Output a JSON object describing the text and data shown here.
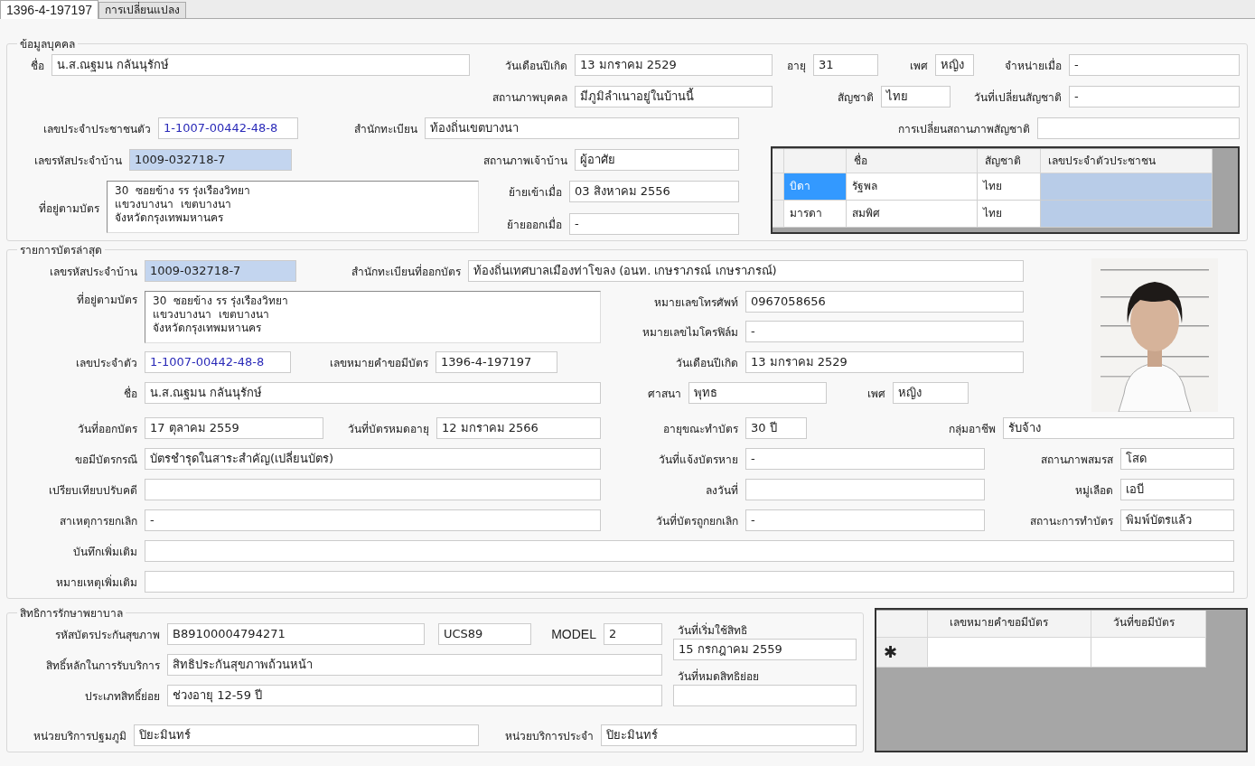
{
  "tabs": [
    {
      "label": "1396-4-197197",
      "selected": true
    },
    {
      "label": "การเปลี่ยนแปลง",
      "selected": false
    }
  ],
  "personal": {
    "title": "ข้อมูลบุคคล",
    "fields": [
      {
        "kind": "label",
        "text": "ชื่อ"
      },
      {
        "kind": "field",
        "value": "น.ส.ณฐมน กลันนุรักษ์"
      },
      {
        "kind": "label",
        "text": "วันเดือนปีเกิด"
      },
      {
        "kind": "field",
        "value": "13 มกราคม 2529"
      },
      {
        "kind": "label",
        "text": "อายุ"
      },
      {
        "kind": "field",
        "value": "31"
      },
      {
        "kind": "label",
        "text": "เพศ"
      },
      {
        "kind": "field",
        "value": "หญิง"
      },
      {
        "kind": "label",
        "text": "จำหน่ายเมื่อ"
      },
      {
        "kind": "field",
        "value": "-"
      },
      {
        "kind": "label",
        "text": "สถานภาพบุคคล"
      },
      {
        "kind": "field",
        "value": "มีภูมิลำเนาอยู่ในบ้านนี้"
      },
      {
        "kind": "label",
        "text": "สัญชาติ"
      },
      {
        "kind": "field",
        "value": "ไทย"
      },
      {
        "kind": "label",
        "text": "วันที่เปลี่ยนสัญชาติ"
      },
      {
        "kind": "field",
        "value": "-"
      },
      {
        "kind": "label",
        "text": "เลขประจำประชาชนตัว"
      },
      {
        "kind": "field",
        "value": "1-1007-00442-48-8",
        "accent": true
      },
      {
        "kind": "label",
        "text": "สำนักทะเบียน"
      },
      {
        "kind": "field",
        "value": "ท้องถิ่นเขตบางนา"
      },
      {
        "kind": "label",
        "text": "การเปลี่ยนสถานภาพสัญชาติ"
      },
      {
        "kind": "field"
      },
      {
        "kind": "label",
        "text": "เลขรหัสประจำบ้าน"
      },
      {
        "kind": "field",
        "value": "1009-032718-7",
        "highlighted": true
      },
      {
        "kind": "label",
        "text": "สถานภาพเจ้าบ้าน"
      },
      {
        "kind": "field",
        "value": "ผู้อาศัย"
      },
      {
        "kind": "label",
        "text": "ที่อยู่ตามบัตร"
      },
      {
        "kind": "textarea",
        "lines": [
          "30  ซอยข้าง รร รุ่งเรืองวิทยา",
          "แขวงบางนา  เขตบางนา",
          "จังหวัดกรุงเทพมหานคร"
        ]
      },
      {
        "kind": "label",
        "text": "ย้ายเข้าเมื่อ"
      },
      {
        "kind": "field",
        "value": "03 สิงหาคม 2556"
      },
      {
        "kind": "label",
        "text": "ย้ายออกเมื่อ"
      },
      {
        "kind": "field",
        "value": "-"
      }
    ],
    "parents_table": {
      "columns": [
        "ชื่อ",
        "สัญชาติ",
        "เลขประจำตัวประชาชน"
      ],
      "rows": [
        {
          "relation": "บิดา",
          "name": "รัฐพล",
          "nationality": "ไทย",
          "focused": true,
          "selected": true
        },
        {
          "relation": "มารดา",
          "name": "สมพิศ",
          "nationality": "ไทย",
          "focused": false,
          "selected": true
        }
      ]
    }
  },
  "card": {
    "title": "รายการบัตรล่าสุด",
    "fields": [
      {
        "kind": "label",
        "text": "เลขรหัสประจำบ้าน"
      },
      {
        "kind": "field",
        "value": "1009-032718-7",
        "highlighted": true
      },
      {
        "kind": "label",
        "text": "สำนักทะเบียนที่ออกบัตร"
      },
      {
        "kind": "field",
        "value": "ท้องถิ่นเทศบาลเมืองท่าโขลง (อนท. เกษราภรณ์ เกษราภรณ์)"
      },
      {
        "kind": "label",
        "text": "ที่อยู่ตามบัตร"
      },
      {
        "kind": "textarea",
        "lines": [
          "30  ซอยข้าง รร รุ่งเรืองวิทยา",
          "แขวงบางนา  เขตบางนา",
          "จังหวัดกรุงเทพมหานคร"
        ]
      },
      {
        "kind": "label",
        "text": "หมายเลขโทรศัพท์"
      },
      {
        "kind": "field",
        "value": "0967058656"
      },
      {
        "kind": "label",
        "text": "หมายเลขไมโครฟิล์ม"
      },
      {
        "kind": "field",
        "value": "-"
      },
      {
        "kind": "label",
        "text": "เลขประจำตัว"
      },
      {
        "kind": "field",
        "value": "1-1007-00442-48-8",
        "accent": true
      },
      {
        "kind": "label",
        "text": "เลขหมายคำขอมีบัตร"
      },
      {
        "kind": "field",
        "value": "1396-4-197197"
      },
      {
        "kind": "label",
        "text": "วันเดือนปีเกิด"
      },
      {
        "kind": "field",
        "value": "13 มกราคม 2529"
      },
      {
        "kind": "label",
        "text": "ชื่อ"
      },
      {
        "kind": "field",
        "value": "น.ส.ณฐมน กลันนุรักษ์"
      },
      {
        "kind": "label",
        "text": "ศาสนา"
      },
      {
        "kind": "field",
        "value": "พุทธ"
      },
      {
        "kind": "label",
        "text": "เพศ"
      },
      {
        "kind": "field",
        "value": "หญิง"
      },
      {
        "kind": "label",
        "text": "วันที่ออกบัตร"
      },
      {
        "kind": "field",
        "value": "17 ตุลาคม 2559"
      },
      {
        "kind": "label",
        "text": "วันที่บัตรหมดอายุ"
      },
      {
        "kind": "field",
        "value": "12 มกราคม 2566"
      },
      {
        "kind": "label",
        "text": "อายุขณะทำบัตร"
      },
      {
        "kind": "field",
        "value": "30 ปี"
      },
      {
        "kind": "label",
        "text": "กลุ่มอาชีพ"
      },
      {
        "kind": "field",
        "value": "รับจ้าง"
      },
      {
        "kind": "label",
        "text": "ขอมีบัตรกรณี"
      },
      {
        "kind": "field",
        "value": "บัตรชำรุดในสาระสำคัญ(เปลี่ยนบัตร)"
      },
      {
        "kind": "label",
        "text": "วันที่แจ้งบัตรหาย"
      },
      {
        "kind": "field",
        "value": "-"
      },
      {
        "kind": "label",
        "text": "สถานภาพสมรส"
      },
      {
        "kind": "field",
        "value": "โสด"
      },
      {
        "kind": "label",
        "text": "เปรียบเทียบปรับคดี"
      },
      {
        "kind": "field"
      },
      {
        "kind": "label",
        "text": "ลงวันที่"
      },
      {
        "kind": "field"
      },
      {
        "kind": "label",
        "text": "หมู่เลือด"
      },
      {
        "kind": "field",
        "value": "เอบี"
      },
      {
        "kind": "label",
        "text": "สาเหตุการยกเลิก"
      },
      {
        "kind": "field",
        "value": "-"
      },
      {
        "kind": "label",
        "text": "วันที่บัตรถูกยกเลิก"
      },
      {
        "kind": "field",
        "value": "-"
      },
      {
        "kind": "label",
        "text": "สถานะการทำบัตร"
      },
      {
        "kind": "field",
        "value": "พิมพ์บัตรแล้ว"
      },
      {
        "kind": "label",
        "text": "บันทึกเพิ่มเติม"
      },
      {
        "kind": "field"
      },
      {
        "kind": "label",
        "text": "หมายเหตุเพิ่มเติม"
      },
      {
        "kind": "field"
      }
    ]
  },
  "health": {
    "title": "สิทธิการรักษาพยาบาล",
    "fields": [
      {
        "kind": "label",
        "text": "รหัสบัตรประกันสุขภาพ"
      },
      {
        "kind": "field",
        "value": "B89100004794271"
      },
      {
        "kind": "field",
        "value": "UCS89"
      },
      {
        "kind": "label",
        "text": "MODEL"
      },
      {
        "kind": "field",
        "value": "2"
      },
      {
        "kind": "label",
        "text": "สิทธิ์หลักในการรับบริการ"
      },
      {
        "kind": "field",
        "value": "สิทธิประกันสุขภาพถ้วนหน้า"
      },
      {
        "kind": "label",
        "text": "ประเภทสิทธิ์ย่อย"
      },
      {
        "kind": "field",
        "value": "ช่วงอายุ 12-59 ปี"
      },
      {
        "kind": "label",
        "text": "หน่วยบริการปฐมภูมิ"
      },
      {
        "kind": "field",
        "value": "ปิยะมินทร์"
      },
      {
        "kind": "label",
        "text": "หน่วยบริการประจำ"
      },
      {
        "kind": "field",
        "value": "ปิยะมินทร์"
      }
    ],
    "side": [
      {
        "kind": "label",
        "text": "วันที่เริ่มใช้สิทธิ"
      },
      {
        "kind": "field",
        "value": "15 กรกฎาคม 2559"
      },
      {
        "kind": "label",
        "text": "วันที่หมดสิทธิย่อย"
      },
      {
        "kind": "field"
      }
    ]
  },
  "requests_table": {
    "columns": [
      "เลขหมายคำขอมีบัตร",
      "วันที่ขอมีบัตร"
    ],
    "new_row_marker": "✱"
  }
}
